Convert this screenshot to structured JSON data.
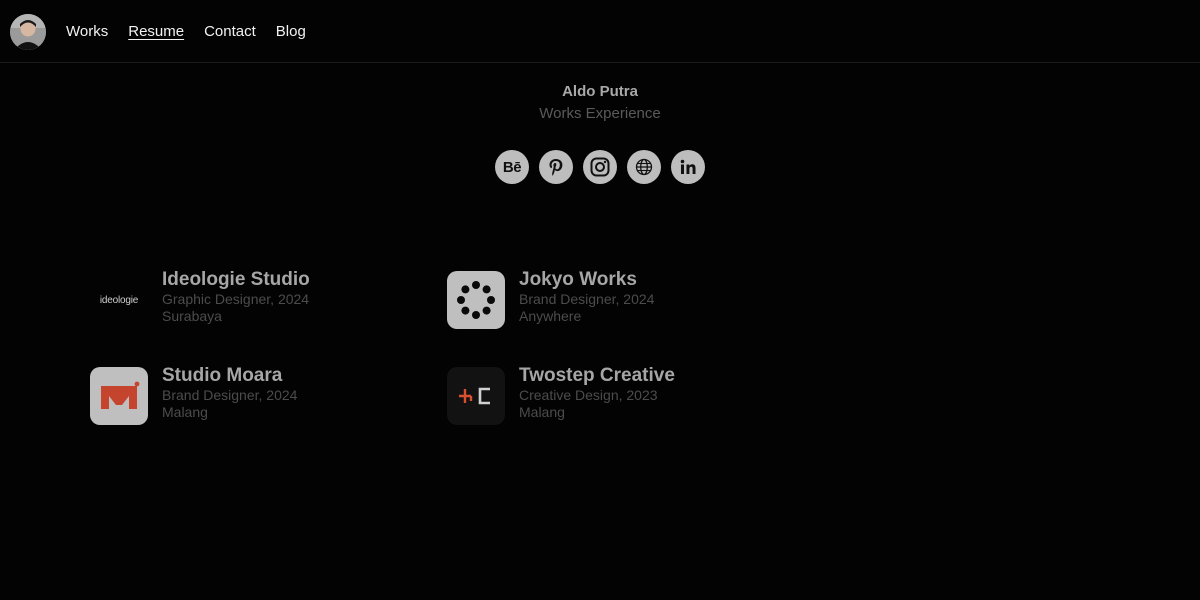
{
  "nav": {
    "links": [
      {
        "label": "Works",
        "active": false
      },
      {
        "label": "Resume",
        "active": true
      },
      {
        "label": "Contact",
        "active": false
      },
      {
        "label": "Blog",
        "active": false
      }
    ]
  },
  "profile": {
    "name": "Aldo Putra",
    "subtitle": "Works Experience"
  },
  "socials": [
    {
      "icon": "behance-icon",
      "text": "Bē"
    },
    {
      "icon": "pinterest-icon"
    },
    {
      "icon": "instagram-icon"
    },
    {
      "icon": "globe-icon"
    },
    {
      "icon": "linkedin-icon"
    }
  ],
  "experience": [
    {
      "company": "Ideologie Studio",
      "role": "Graphic Designer, 2024",
      "location": "Surabaya",
      "logo_text": "ideologie"
    },
    {
      "company": "Jokyo Works",
      "role": "Brand Designer, 2024",
      "location": "Anywhere"
    },
    {
      "company": "Studio Moara",
      "role": "Brand Designer, 2024",
      "location": "Malang"
    },
    {
      "company": "Twostep Creative",
      "role": "Creative Design, 2023",
      "location": "Malang"
    }
  ],
  "colors": {
    "background": "#030303",
    "moara_brand": "#c5442d",
    "twostep_accent": "#d9502f"
  }
}
